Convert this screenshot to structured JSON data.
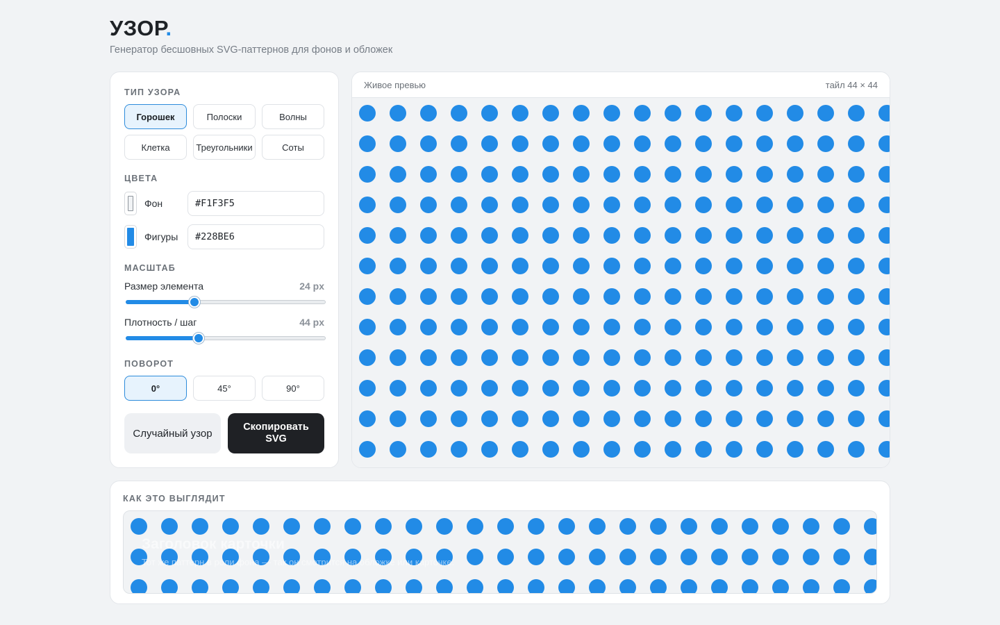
{
  "app": {
    "logo_text": "УЗОР",
    "logo_dot": ".",
    "subtitle": "Генератор бесшовных SVG-паттернов для фонов и обложек"
  },
  "pattern_type": {
    "title": "ТИП УЗОРА",
    "options": [
      "Горошек",
      "Полоски",
      "Волны",
      "Клетка",
      "Треугольники",
      "Соты"
    ],
    "selected": "Горошек"
  },
  "colors": {
    "title": "ЦВЕТА",
    "background": {
      "label": "Фон",
      "value": "#F1F3F5"
    },
    "shapes": {
      "label": "Фигуры",
      "value": "#228BE6"
    }
  },
  "scale": {
    "title": "МАСШТАБ",
    "element_size": {
      "label": "Размер элемента",
      "value": 24,
      "value_text": "24 px",
      "fraction": 0.34
    },
    "density": {
      "label": "Плотность / шаг",
      "value": 44,
      "value_text": "44 px",
      "fraction": 0.36
    }
  },
  "rotation": {
    "title": "ПОВОРОТ",
    "options": [
      "0°",
      "45°",
      "90°"
    ],
    "selected": "0°"
  },
  "actions": {
    "random_label": "Случайный узор",
    "copy_label": "Скопировать SVG"
  },
  "preview": {
    "title": "Живое превью",
    "tile_label": "тайл 44 × 44"
  },
  "demo": {
    "title": "КАК ЭТО ВЫГЛЯДИТ",
    "card_title": "Заголовок карточки",
    "card_text": "Тот же паттерн в роли фона — так он смотрится на обложке или карточке."
  }
}
